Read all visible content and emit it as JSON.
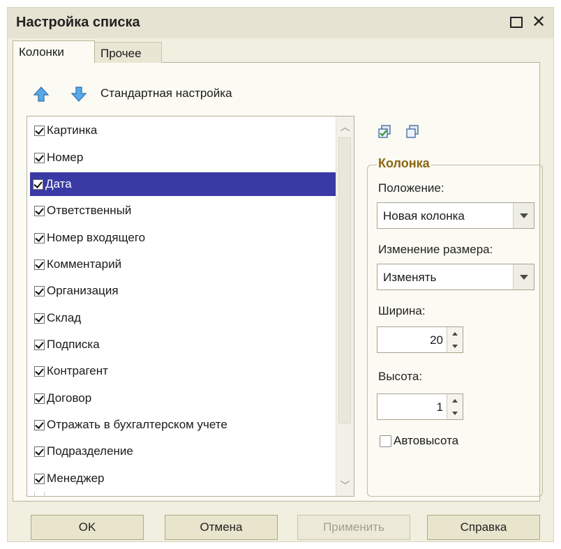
{
  "window": {
    "title": "Настройка списка"
  },
  "tabs": [
    {
      "label": "Колонки",
      "active": true
    },
    {
      "label": "Прочее",
      "active": false
    }
  ],
  "toolbar": {
    "move_up_icon": "arrow-up-icon",
    "move_down_icon": "arrow-down-icon",
    "standard_setting_label": "Стандартная настройка"
  },
  "columns_list": {
    "items": [
      {
        "label": "Картинка",
        "checked": true,
        "selected": false
      },
      {
        "label": "Номер",
        "checked": true,
        "selected": false
      },
      {
        "label": "Дата",
        "checked": true,
        "selected": true
      },
      {
        "label": "Ответственный",
        "checked": true,
        "selected": false
      },
      {
        "label": "Номер входящего",
        "checked": true,
        "selected": false
      },
      {
        "label": "Комментарий",
        "checked": true,
        "selected": false
      },
      {
        "label": "Организация",
        "checked": true,
        "selected": false
      },
      {
        "label": "Склад",
        "checked": true,
        "selected": false
      },
      {
        "label": "Подписка",
        "checked": true,
        "selected": false
      },
      {
        "label": "Контрагент",
        "checked": true,
        "selected": false
      },
      {
        "label": "Договор",
        "checked": true,
        "selected": false
      },
      {
        "label": "Отражать в бухгалтерском учете",
        "checked": true,
        "selected": false
      },
      {
        "label": "Подразделение",
        "checked": true,
        "selected": false
      },
      {
        "label": "Менеджер",
        "checked": true,
        "selected": false
      }
    ]
  },
  "column_panel": {
    "check_all_icon": "check-all-icon",
    "uncheck_all_icon": "uncheck-all-icon",
    "group_title": "Колонка",
    "position_label": "Положение:",
    "position_value": "Новая колонка",
    "resize_label": "Изменение размера:",
    "resize_value": "Изменять",
    "width_label": "Ширина:",
    "width_value": "20",
    "height_label": "Высота:",
    "height_value": "1",
    "autoheight_label": "Автовысота",
    "autoheight_checked": false
  },
  "buttons": {
    "ok": "OK",
    "cancel": "Отмена",
    "apply": "Применить",
    "help": "Справка"
  },
  "colors": {
    "selection": "#3a3aa4",
    "group_title": "#8a6410",
    "window_bg": "#f1efdf"
  }
}
